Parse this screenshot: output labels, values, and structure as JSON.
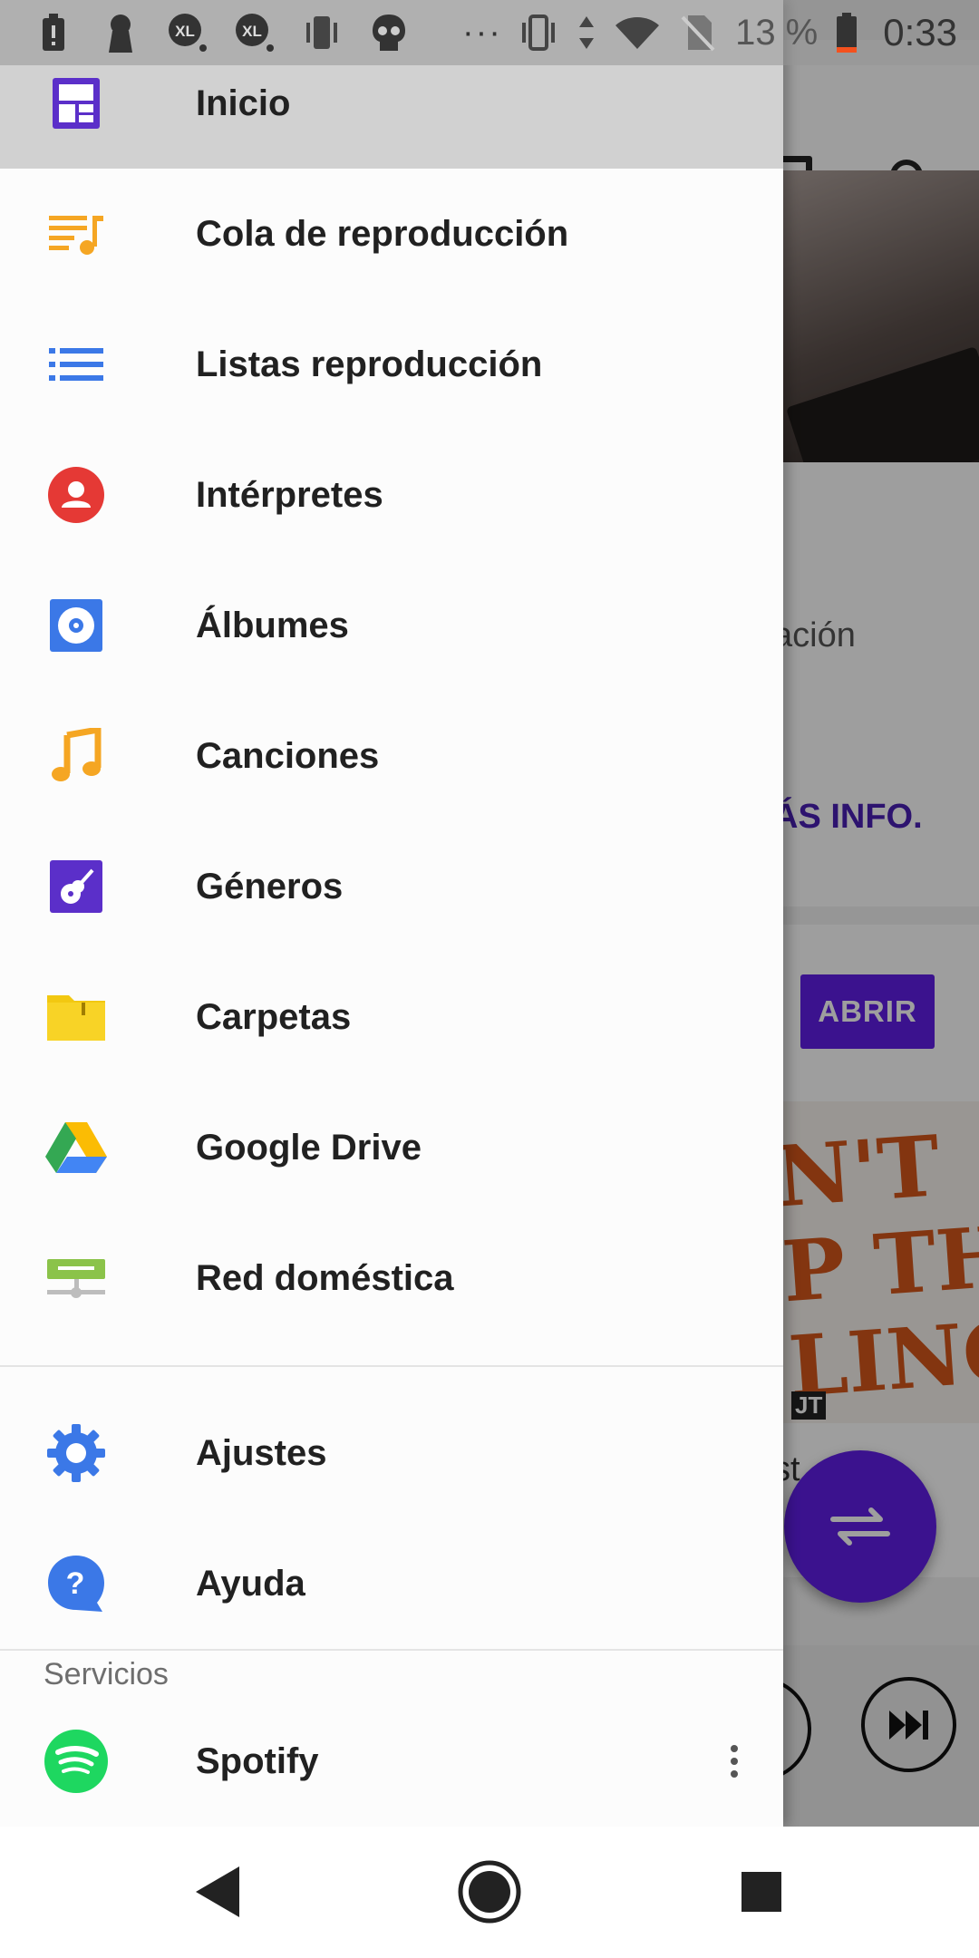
{
  "status_bar": {
    "battery_percent": "13 %",
    "time": "0:33",
    "overflow": "···",
    "icons": [
      "battery-alert-icon",
      "keyhole-icon",
      "xl-search-icon",
      "xl-search-icon",
      "vibrate-icon",
      "skull-icon",
      "vibrate-icon",
      "data-arrows-icon",
      "wifi-icon",
      "no-sim-icon",
      "battery-low-icon"
    ]
  },
  "background": {
    "partial_text": "ación",
    "more_info_partial": "ÁS INFO.",
    "open_button": "ABRIR",
    "album_art_text": "N'T\nP THE\nLING!",
    "album_tag": "JT",
    "card_partial": "st"
  },
  "drawer": {
    "header": {
      "label": "Inicio",
      "icon": "home-grid-icon",
      "accent": "#5b2fc9"
    },
    "items": [
      {
        "label": "Cola de reproducción",
        "icon": "queue-music-icon",
        "color": "#f5a623"
      },
      {
        "label": "Listas reproducción",
        "icon": "playlist-icon",
        "color": "#3b78e7"
      },
      {
        "label": "Intérpretes",
        "icon": "artist-icon",
        "color": "#e53935"
      },
      {
        "label": "Álbumes",
        "icon": "album-icon",
        "color": "#3b78e7"
      },
      {
        "label": "Canciones",
        "icon": "music-note-icon",
        "color": "#f5a623"
      },
      {
        "label": "Géneros",
        "icon": "guitar-icon",
        "color": "#5b2fc9"
      },
      {
        "label": "Carpetas",
        "icon": "folder-icon",
        "color": "#f2c811"
      },
      {
        "label": "Google Drive",
        "icon": "google-drive-icon",
        "color": "#34a853"
      },
      {
        "label": "Red doméstica",
        "icon": "home-network-icon",
        "color": "#8bc34a"
      }
    ],
    "settings": [
      {
        "label": "Ajustes",
        "icon": "gear-icon",
        "color": "#3b78e7"
      },
      {
        "label": "Ayuda",
        "icon": "help-icon",
        "color": "#3b78e7"
      }
    ],
    "services_title": "Servicios",
    "services": [
      {
        "label": "Spotify",
        "icon": "spotify-icon",
        "color": "#1ed760"
      }
    ]
  },
  "nav_bar": {
    "buttons": [
      "back-icon",
      "home-icon",
      "recents-icon"
    ]
  }
}
